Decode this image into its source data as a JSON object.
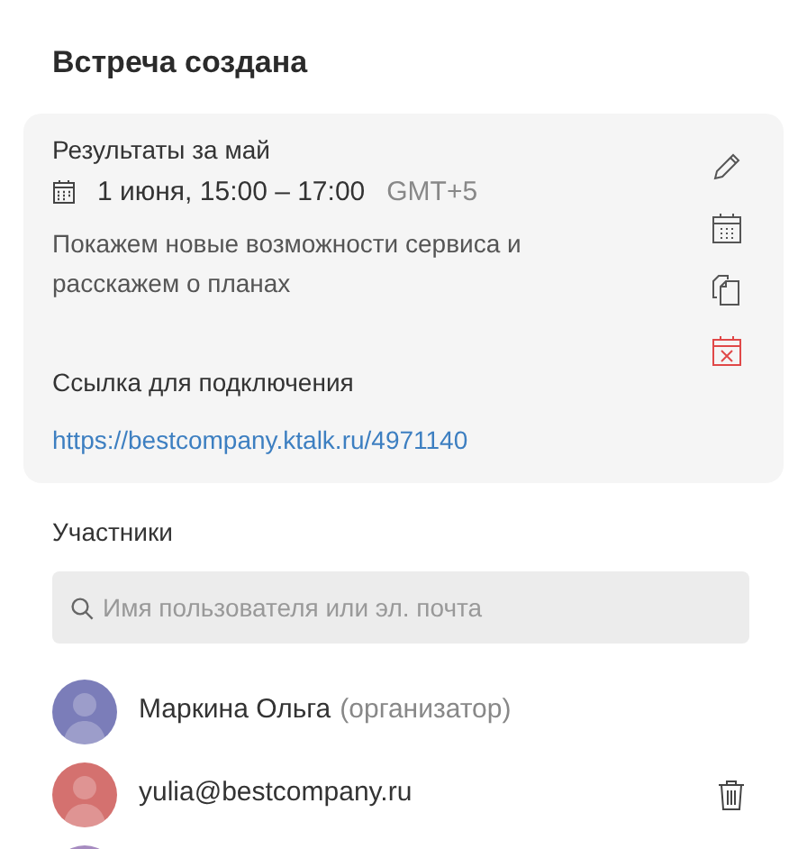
{
  "title": "Встреча создана",
  "meeting": {
    "name": "Результаты за май",
    "datetime": "1 июня, 15:00 – 17:00",
    "timezone": "GMT+5",
    "description": "Покажем новые возможности сервиса и расскажем о планах",
    "link_label": "Ссылка для подключения",
    "link": "https://bestcompany.ktalk.ru/4971140"
  },
  "participants": {
    "heading": "Участники",
    "search": {
      "placeholder": "Имя пользователя или эл. почта"
    },
    "items": [
      {
        "name": "Маркина Ольга",
        "role": "(организатор)",
        "color": "#7b7db9",
        "removable": false
      },
      {
        "name": "yulia@bestcompany.ru",
        "color": "#d4716f",
        "removable": true
      },
      {
        "color": "#a68bc0",
        "removable": false
      }
    ]
  }
}
